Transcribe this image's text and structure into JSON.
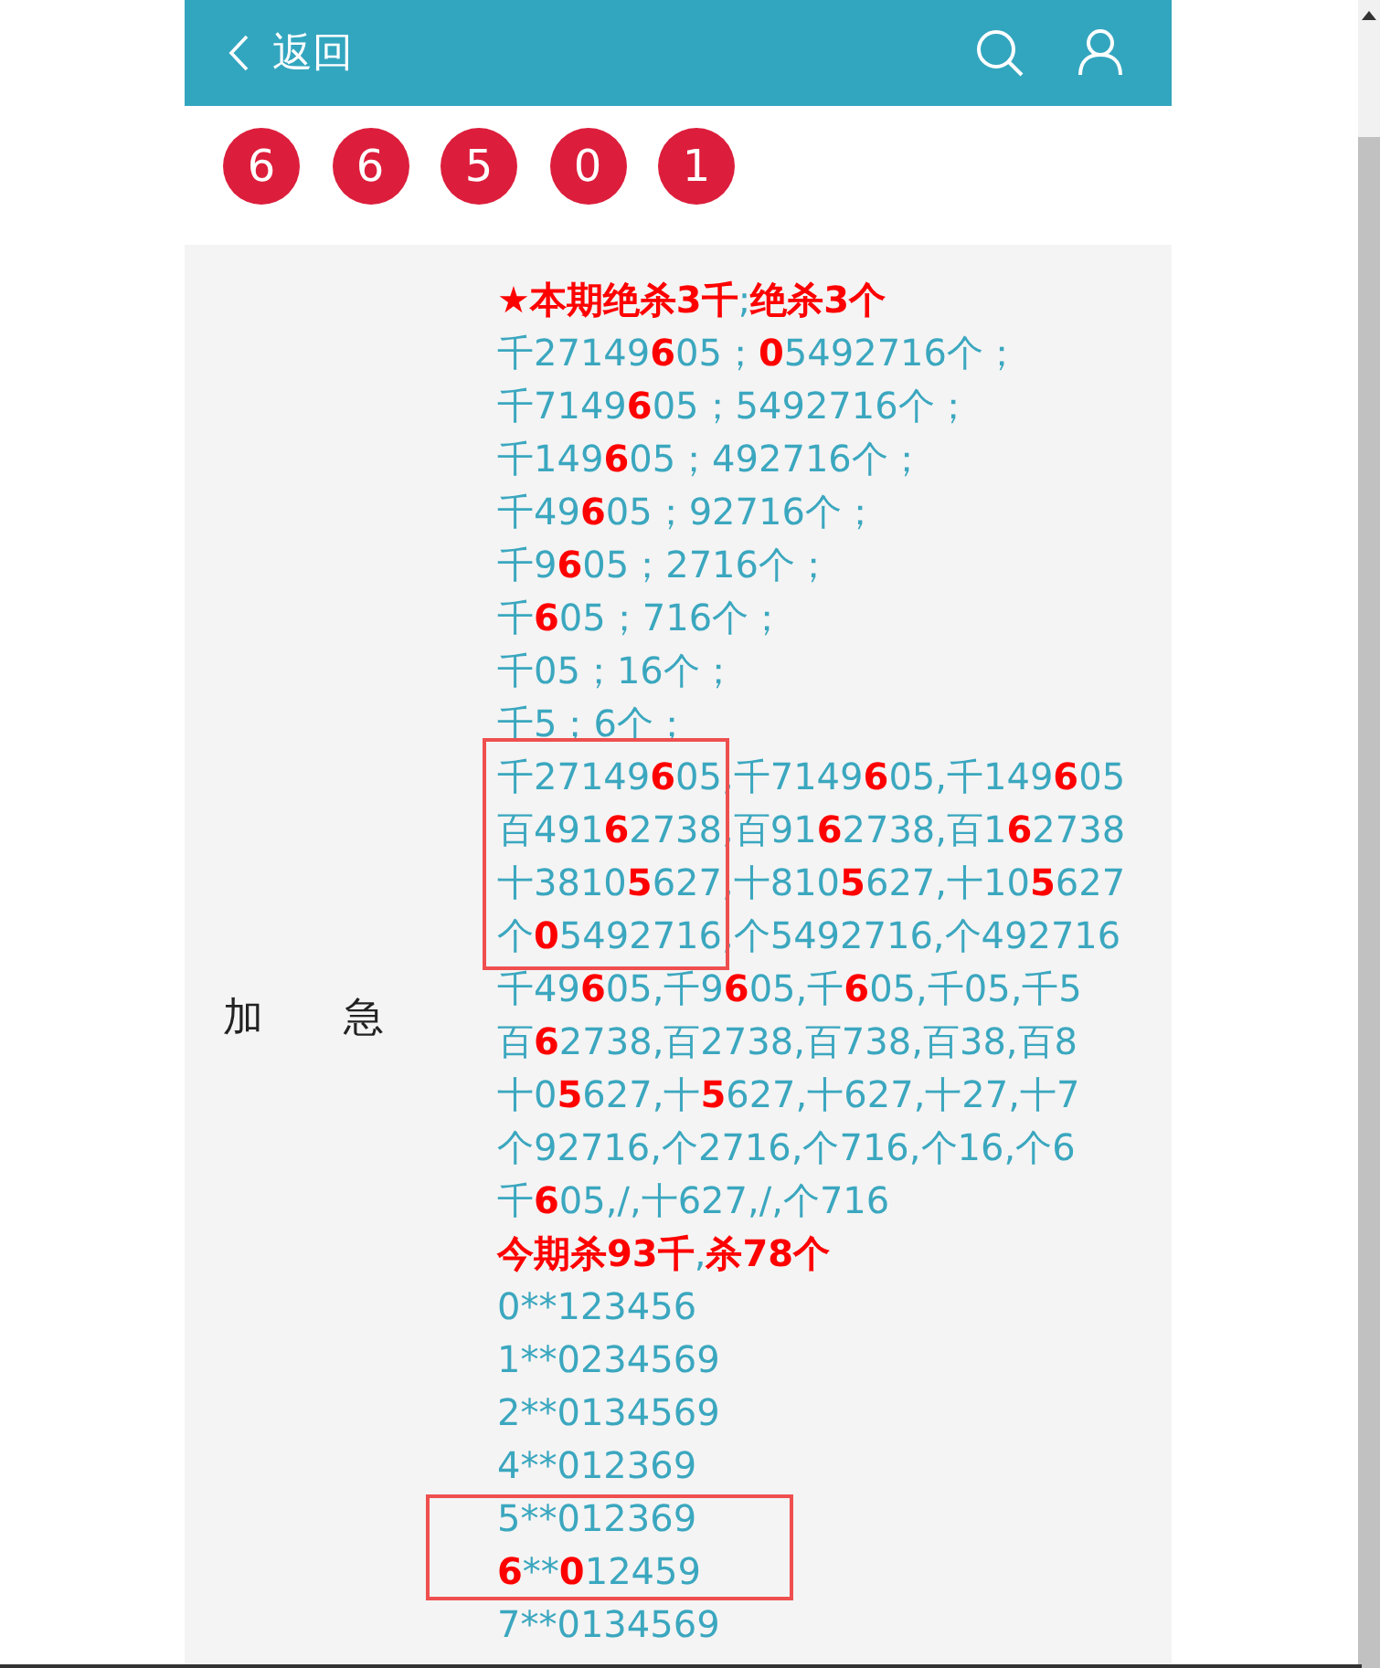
{
  "header": {
    "back_label": "返回"
  },
  "draw_numbers": [
    "6",
    "6",
    "5",
    "0",
    "1"
  ],
  "table": {
    "label": "加　　急",
    "lines": [
      {
        "segments": [
          {
            "text": "★本期绝杀3千",
            "highlight": true
          },
          {
            "text": ";",
            "highlight": false
          },
          {
            "text": "绝杀3个",
            "highlight": true
          }
        ]
      },
      {
        "segments": [
          {
            "text": "千27149",
            "highlight": false
          },
          {
            "text": "6",
            "highlight": true
          },
          {
            "text": "05；",
            "highlight": false
          },
          {
            "text": "0",
            "highlight": true
          },
          {
            "text": "5492716个；",
            "highlight": false
          }
        ]
      },
      {
        "segments": [
          {
            "text": "千7149",
            "highlight": false
          },
          {
            "text": "6",
            "highlight": true
          },
          {
            "text": "05；5492716个；",
            "highlight": false
          }
        ]
      },
      {
        "segments": [
          {
            "text": "千149",
            "highlight": false
          },
          {
            "text": "6",
            "highlight": true
          },
          {
            "text": "05；492716个；",
            "highlight": false
          }
        ]
      },
      {
        "segments": [
          {
            "text": "千49",
            "highlight": false
          },
          {
            "text": "6",
            "highlight": true
          },
          {
            "text": "05；92716个；",
            "highlight": false
          }
        ]
      },
      {
        "segments": [
          {
            "text": "千9",
            "highlight": false
          },
          {
            "text": "6",
            "highlight": true
          },
          {
            "text": "05；2716个；",
            "highlight": false
          }
        ]
      },
      {
        "segments": [
          {
            "text": "千",
            "highlight": false
          },
          {
            "text": "6",
            "highlight": true
          },
          {
            "text": "05；716个；",
            "highlight": false
          }
        ]
      },
      {
        "segments": [
          {
            "text": "千05；16个；",
            "highlight": false
          }
        ]
      },
      {
        "segments": [
          {
            "text": "千5；6个；",
            "highlight": false
          }
        ]
      },
      {
        "segments": [
          {
            "text": "千27149",
            "highlight": false
          },
          {
            "text": "6",
            "highlight": true
          },
          {
            "text": "05,千7149",
            "highlight": false
          },
          {
            "text": "6",
            "highlight": true
          },
          {
            "text": "05,千149",
            "highlight": false
          },
          {
            "text": "6",
            "highlight": true
          },
          {
            "text": "05",
            "highlight": false
          }
        ]
      },
      {
        "segments": [
          {
            "text": "百491",
            "highlight": false
          },
          {
            "text": "6",
            "highlight": true
          },
          {
            "text": "2738,百91",
            "highlight": false
          },
          {
            "text": "6",
            "highlight": true
          },
          {
            "text": "2738,百1",
            "highlight": false
          },
          {
            "text": "6",
            "highlight": true
          },
          {
            "text": "2738",
            "highlight": false
          }
        ]
      },
      {
        "segments": [
          {
            "text": "十3810",
            "highlight": false
          },
          {
            "text": "5",
            "highlight": true
          },
          {
            "text": "627,十810",
            "highlight": false
          },
          {
            "text": "5",
            "highlight": true
          },
          {
            "text": "627,十10",
            "highlight": false
          },
          {
            "text": "5",
            "highlight": true
          },
          {
            "text": "627",
            "highlight": false
          }
        ]
      },
      {
        "segments": [
          {
            "text": "个",
            "highlight": false
          },
          {
            "text": "0",
            "highlight": true
          },
          {
            "text": "5492716,个5492716,个492716",
            "highlight": false
          }
        ]
      },
      {
        "segments": [
          {
            "text": "千49",
            "highlight": false
          },
          {
            "text": "6",
            "highlight": true
          },
          {
            "text": "05,千9",
            "highlight": false
          },
          {
            "text": "6",
            "highlight": true
          },
          {
            "text": "05,千",
            "highlight": false
          },
          {
            "text": "6",
            "highlight": true
          },
          {
            "text": "05,千05,千5",
            "highlight": false
          }
        ]
      },
      {
        "segments": [
          {
            "text": "百",
            "highlight": false
          },
          {
            "text": "6",
            "highlight": true
          },
          {
            "text": "2738,百2738,百738,百38,百8",
            "highlight": false
          }
        ]
      },
      {
        "segments": [
          {
            "text": "十0",
            "highlight": false
          },
          {
            "text": "5",
            "highlight": true
          },
          {
            "text": "627,十",
            "highlight": false
          },
          {
            "text": "5",
            "highlight": true
          },
          {
            "text": "627,十627,十27,十7",
            "highlight": false
          }
        ]
      },
      {
        "segments": [
          {
            "text": "个92716,个2716,个716,个16,个6",
            "highlight": false
          }
        ]
      },
      {
        "segments": [
          {
            "text": "千",
            "highlight": false
          },
          {
            "text": "6",
            "highlight": true
          },
          {
            "text": "05,/,十627,/,个716",
            "highlight": false
          }
        ]
      },
      {
        "segments": [
          {
            "text": "今期杀93千",
            "highlight": true
          },
          {
            "text": ",",
            "highlight": false
          },
          {
            "text": "杀78个",
            "highlight": true
          }
        ]
      },
      {
        "segments": [
          {
            "text": "0**123456",
            "highlight": false
          }
        ]
      },
      {
        "segments": [
          {
            "text": "1**0234569",
            "highlight": false
          }
        ]
      },
      {
        "segments": [
          {
            "text": "2**0134569",
            "highlight": false
          }
        ]
      },
      {
        "segments": [
          {
            "text": "4**012369",
            "highlight": false
          }
        ]
      },
      {
        "segments": [
          {
            "text": "5**012369",
            "highlight": false
          }
        ]
      },
      {
        "segments": [
          {
            "text": "6",
            "highlight": true
          },
          {
            "text": "**",
            "highlight": false
          },
          {
            "text": "0",
            "highlight": true
          },
          {
            "text": "12459",
            "highlight": false
          }
        ]
      },
      {
        "segments": [
          {
            "text": "7**0134569",
            "highlight": false
          }
        ]
      }
    ]
  }
}
